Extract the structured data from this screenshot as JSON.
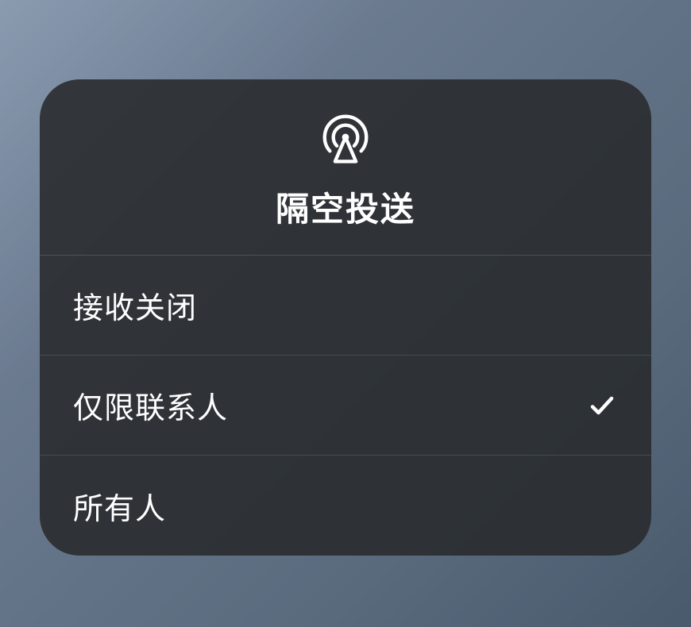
{
  "panel": {
    "title": "隔空投送",
    "icon_name": "airdrop-icon",
    "options": [
      {
        "label": "接收关闭",
        "selected": false
      },
      {
        "label": "仅限联系人",
        "selected": true
      },
      {
        "label": "所有人",
        "selected": false
      }
    ]
  }
}
